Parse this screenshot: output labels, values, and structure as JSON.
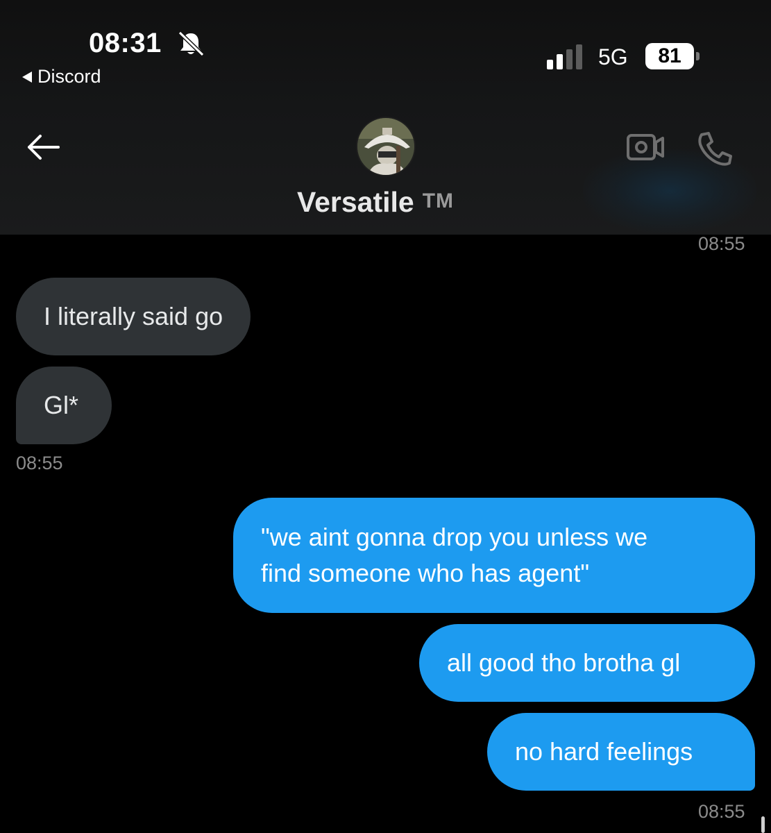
{
  "status_bar": {
    "time": "08:31",
    "back_app": "Discord",
    "network": "5G",
    "battery": "81"
  },
  "conversation": {
    "name": "Versatile",
    "name_suffix": "TM"
  },
  "icons": {
    "bell": "bell-slash-icon",
    "signal": "signal-bars-icon",
    "back": "arrow-left-icon",
    "video": "video-camera-icon",
    "phone": "phone-icon"
  },
  "colors": {
    "incoming_bubble": "#2f3336",
    "outgoing_bubble": "#1d9bf0",
    "timestamp": "#8b8b8b"
  },
  "messages": [
    {
      "direction": "time",
      "text": "08:55"
    },
    {
      "direction": "in",
      "text": "I literally said go"
    },
    {
      "direction": "in",
      "text": "Gl*"
    },
    {
      "direction": "time",
      "text": "08:55"
    },
    {
      "direction": "out",
      "lines": [
        "\"we aint gonna drop you unless we",
        "find someone who has agent\""
      ]
    },
    {
      "direction": "out",
      "text": "all good tho brotha gl"
    },
    {
      "direction": "out",
      "text": "no hard feelings"
    },
    {
      "direction": "time",
      "text": "08:55"
    }
  ]
}
